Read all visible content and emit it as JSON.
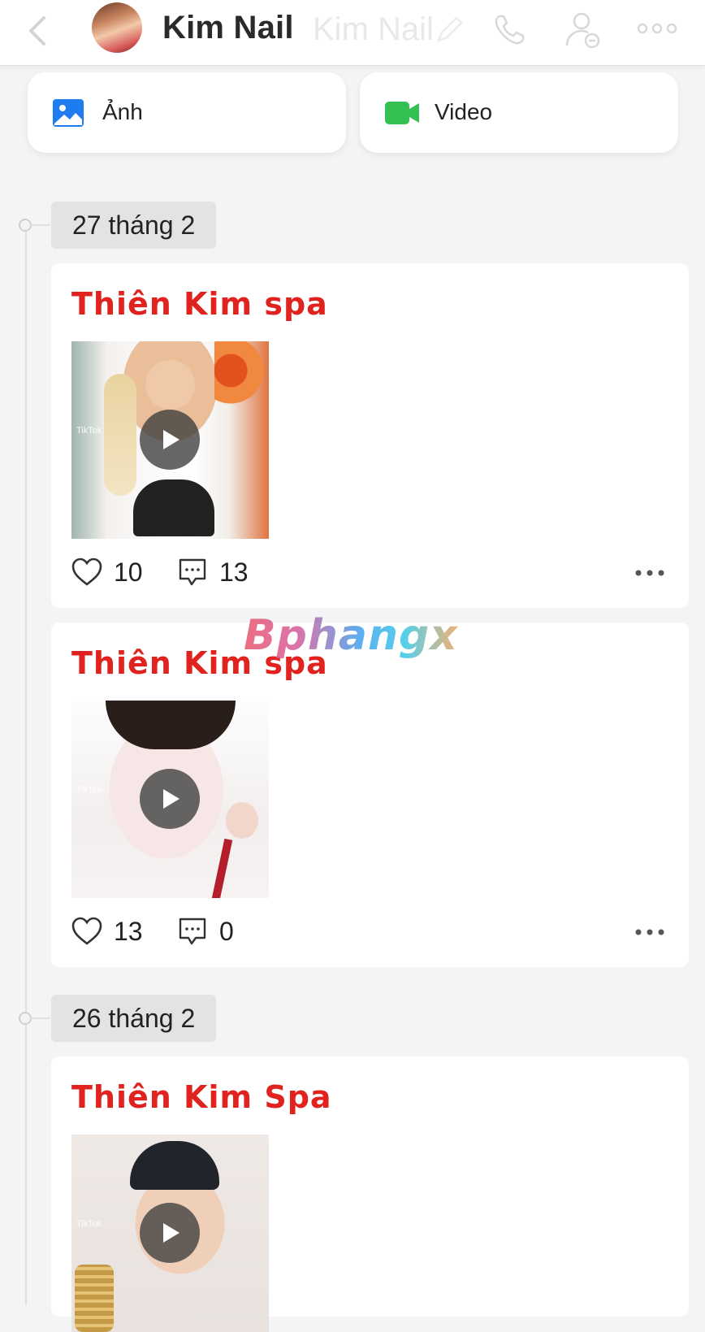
{
  "header": {
    "title": "Kim Nail",
    "ghost_title": "Kim Nail"
  },
  "media_buttons": {
    "photo_label": "Ảnh",
    "video_label": "Video"
  },
  "groups": [
    {
      "date": "27 tháng 2",
      "posts": [
        {
          "author": "Thiên Kim spa",
          "likes": "10",
          "comments": "13",
          "tiktok_tag": "TikTok"
        },
        {
          "author": "Thiên Kim spa",
          "likes": "13",
          "comments": "0",
          "tiktok_tag": "TikTok"
        }
      ]
    },
    {
      "date": "26 tháng 2",
      "posts": [
        {
          "author": "Thiên Kim Spa",
          "tiktok_tag": "TikTok"
        }
      ]
    }
  ],
  "watermark": "Bphangx",
  "colors": {
    "author_red": "#e0231f",
    "photo_icon_blue": "#1e7cf0",
    "video_icon_green": "#34c052"
  },
  "icons": [
    "back-chevron-icon",
    "phone-icon",
    "add-contact-icon",
    "more-icon",
    "image-icon",
    "video-camera-icon",
    "heart-icon",
    "comment-icon",
    "play-icon"
  ]
}
